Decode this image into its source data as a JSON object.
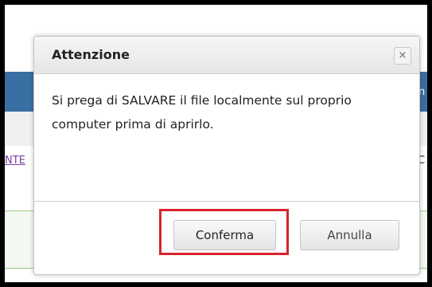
{
  "background": {
    "left_fragment": "NTE",
    "right_fragment": "C",
    "bar_fragment": "n"
  },
  "dialog": {
    "title": "Attenzione",
    "close_icon": "×",
    "message": "Si prega di SALVARE il file localmente sul proprio computer prima di aprirlo.",
    "confirm_label": "Conferma",
    "cancel_label": "Annulla"
  },
  "colors": {
    "highlight": "#d9232e",
    "bar": "#3a6fa3"
  }
}
